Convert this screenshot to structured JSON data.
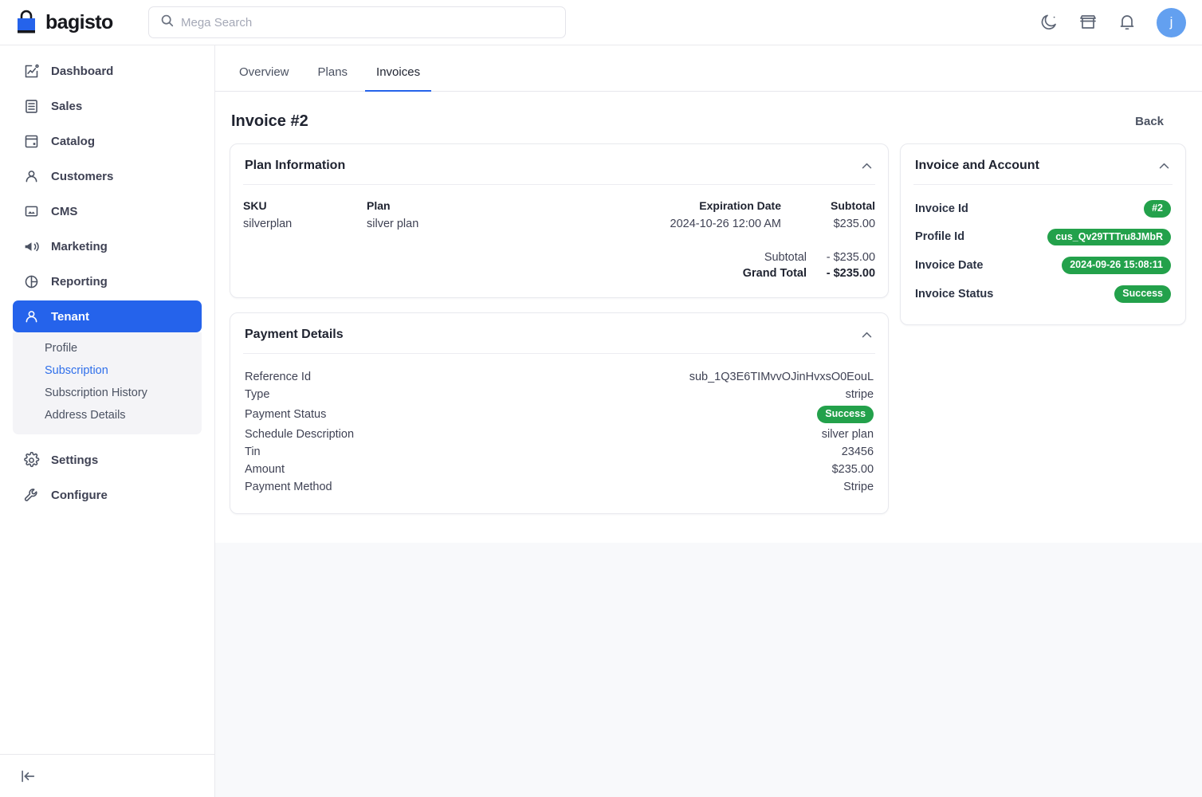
{
  "header": {
    "brand": "bagisto",
    "brand_icon": "shopping-bag-icon",
    "search": {
      "value": "",
      "placeholder": "Mega Search",
      "icon": "search-icon"
    },
    "icons": [
      "moon-icon",
      "store-icon",
      "bell-icon"
    ],
    "avatar_initial": "j",
    "accent_color": "#2563eb"
  },
  "sidebar": {
    "items": [
      {
        "label": "Dashboard",
        "icon": "dashboard-icon",
        "active": false
      },
      {
        "label": "Sales",
        "icon": "sales-icon",
        "active": false
      },
      {
        "label": "Catalog",
        "icon": "catalog-icon",
        "active": false
      },
      {
        "label": "Customers",
        "icon": "customers-icon",
        "active": false
      },
      {
        "label": "CMS",
        "icon": "cms-icon",
        "active": false
      },
      {
        "label": "Marketing",
        "icon": "marketing-icon",
        "active": false
      },
      {
        "label": "Reporting",
        "icon": "reporting-icon",
        "active": false
      },
      {
        "label": "Tenant",
        "icon": "tenant-icon",
        "active": true
      },
      {
        "label": "Settings",
        "icon": "settings-icon",
        "active": false
      },
      {
        "label": "Configure",
        "icon": "configure-icon",
        "active": false
      }
    ],
    "submenu": [
      {
        "label": "Profile",
        "active": false
      },
      {
        "label": "Subscription",
        "active": true
      },
      {
        "label": "Subscription History",
        "active": false
      },
      {
        "label": "Address Details",
        "active": false
      }
    ],
    "collapse_icon": "collapse-sidebar-icon"
  },
  "tabs": [
    {
      "label": "Overview",
      "active": false
    },
    {
      "label": "Plans",
      "active": false
    },
    {
      "label": "Invoices",
      "active": true
    }
  ],
  "page": {
    "title": "Invoice #2",
    "back_label": "Back"
  },
  "plan_information": {
    "title": "Plan Information",
    "collapse_icon": "chevron-up-icon",
    "headers": [
      "SKU",
      "Plan",
      "Expiration Date",
      "Subtotal"
    ],
    "row": {
      "sku": "silverplan",
      "plan": "silver plan",
      "expiration_date": "2024-10-26 12:00 AM",
      "subtotal": "$235.00"
    },
    "totals": [
      {
        "label": "Subtotal",
        "value": "- $235.00",
        "bold": false
      },
      {
        "label": "Grand Total",
        "value": "- $235.00",
        "bold": true
      }
    ]
  },
  "payment_details": {
    "title": "Payment Details",
    "collapse_icon": "chevron-up-icon",
    "rows": [
      {
        "label": "Reference Id",
        "value": "sub_1Q3E6TIMvvOJinHvxsO0EouL",
        "badge": false
      },
      {
        "label": "Type",
        "value": "stripe",
        "badge": false
      },
      {
        "label": "Payment Status",
        "value": "Success",
        "badge": true
      },
      {
        "label": "Schedule Description",
        "value": "silver plan",
        "badge": false
      },
      {
        "label": "Tin",
        "value": "23456",
        "badge": false
      },
      {
        "label": "Amount",
        "value": "$235.00",
        "badge": false
      },
      {
        "label": "Payment Method",
        "value": "Stripe",
        "badge": false
      }
    ]
  },
  "invoice_and_account": {
    "title": "Invoice and Account",
    "collapse_icon": "chevron-up-icon",
    "badge_color": "#23a14b",
    "rows": [
      {
        "label": "Invoice Id",
        "value": "#2"
      },
      {
        "label": "Profile Id",
        "value": "cus_Qv29TTTru8JMbR"
      },
      {
        "label": "Invoice Date",
        "value": "2024-09-26 15:08:11"
      },
      {
        "label": "Invoice Status",
        "value": "Success"
      }
    ]
  }
}
